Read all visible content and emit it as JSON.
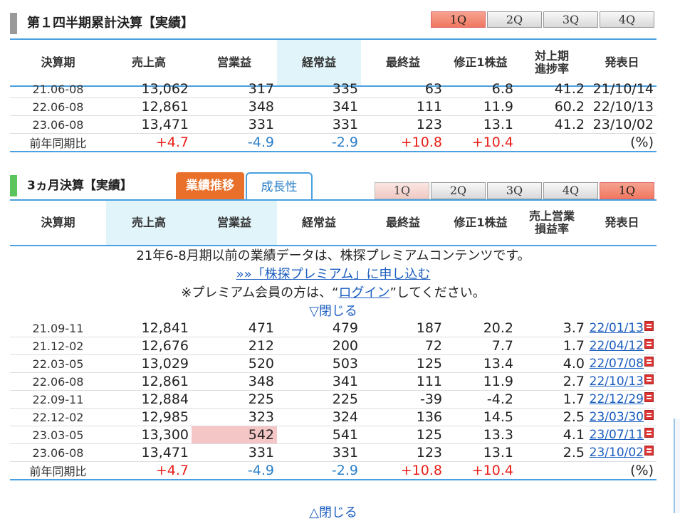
{
  "section1": {
    "title": "第１四半期累計決算【実績】",
    "quarter_tabs": [
      "1Q",
      "2Q",
      "3Q",
      "4Q"
    ],
    "active_tab": "1Q",
    "headers": [
      "決算期",
      "売上高",
      "営業益",
      "経常益",
      "最終益",
      "修正1株益",
      "対上期\n進捗率",
      "発表日"
    ],
    "rows": [
      [
        "21.06-08",
        "13,062",
        "317",
        "335",
        "63",
        "6.8",
        "41.2",
        "21/10/14"
      ],
      [
        "22.06-08",
        "12,861",
        "348",
        "341",
        "111",
        "11.9",
        "60.2",
        "22/10/13"
      ],
      [
        "23.06-08",
        "13,471",
        "331",
        "331",
        "123",
        "13.1",
        "41.2",
        "23/10/02"
      ]
    ],
    "yoy": {
      "label": "前年同期比",
      "values": [
        "+4.7",
        "-4.9",
        "-2.9",
        "+10.8",
        "+10.4"
      ],
      "unit": "(%)"
    }
  },
  "section2": {
    "title": "3ヵ月決算【実績】",
    "view_tabs": [
      "業績推移",
      "成長性"
    ],
    "quarter_tabs": [
      "1Q",
      "2Q",
      "3Q",
      "4Q",
      "1Q"
    ],
    "headers": [
      "決算期",
      "売上高",
      "営業益",
      "経常益",
      "最終益",
      "修正1株益",
      "売上営業\n損益率",
      "発表日"
    ],
    "notice": {
      "line1": "21年6-8月期以前の業績データは、株探プレミアムコンテンツです。",
      "signup_link": "»»「株探プレミアム」に申し込む",
      "line3_before": "※プレミアム会員の方は、“",
      "login_link": "ログイン",
      "line3_after": "”してください。",
      "close": "▽閉じる"
    },
    "rows": [
      [
        "21.09-11",
        "12,841",
        "471",
        "479",
        "187",
        "20.2",
        "3.7",
        "22/01/13"
      ],
      [
        "21.12-02",
        "12,676",
        "212",
        "200",
        "72",
        "7.7",
        "1.7",
        "22/04/12"
      ],
      [
        "22.03-05",
        "13,029",
        "520",
        "503",
        "125",
        "13.4",
        "4.0",
        "22/07/08"
      ],
      [
        "22.06-08",
        "12,861",
        "348",
        "341",
        "111",
        "11.9",
        "2.7",
        "22/10/13"
      ],
      [
        "22.09-11",
        "12,884",
        "225",
        "225",
        "-39",
        "-4.2",
        "1.7",
        "22/12/29"
      ],
      [
        "22.12-02",
        "12,985",
        "323",
        "324",
        "136",
        "14.5",
        "2.5",
        "23/03/30"
      ],
      [
        "23.03-05",
        "13,300",
        "542",
        "541",
        "125",
        "13.3",
        "4.1",
        "23/07/11"
      ],
      [
        "23.06-08",
        "13,471",
        "331",
        "331",
        "123",
        "13.1",
        "2.5",
        "23/10/02"
      ]
    ],
    "yoy": {
      "label": "前年同期比",
      "values": [
        "+4.7",
        "-4.9",
        "-2.9",
        "+10.8",
        "+10.4"
      ],
      "unit": "(%)"
    },
    "close_bottom": "△閉じる"
  }
}
